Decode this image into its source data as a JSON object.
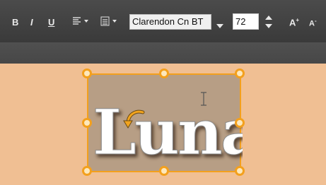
{
  "toolbar": {
    "bold_label": "B",
    "italic_label": "I",
    "underline_label": "U",
    "font_family_value": "Clarendon Cn BT",
    "font_size_value": "72",
    "grow_label": "A",
    "shrink_label": "A"
  },
  "canvas": {
    "text": "Luna"
  },
  "colors": {
    "toolbar_bg": "#454545",
    "canvas_bg": "#f0bf93",
    "selection": "#f3a01d",
    "textbox_bg": "#b79e85"
  }
}
